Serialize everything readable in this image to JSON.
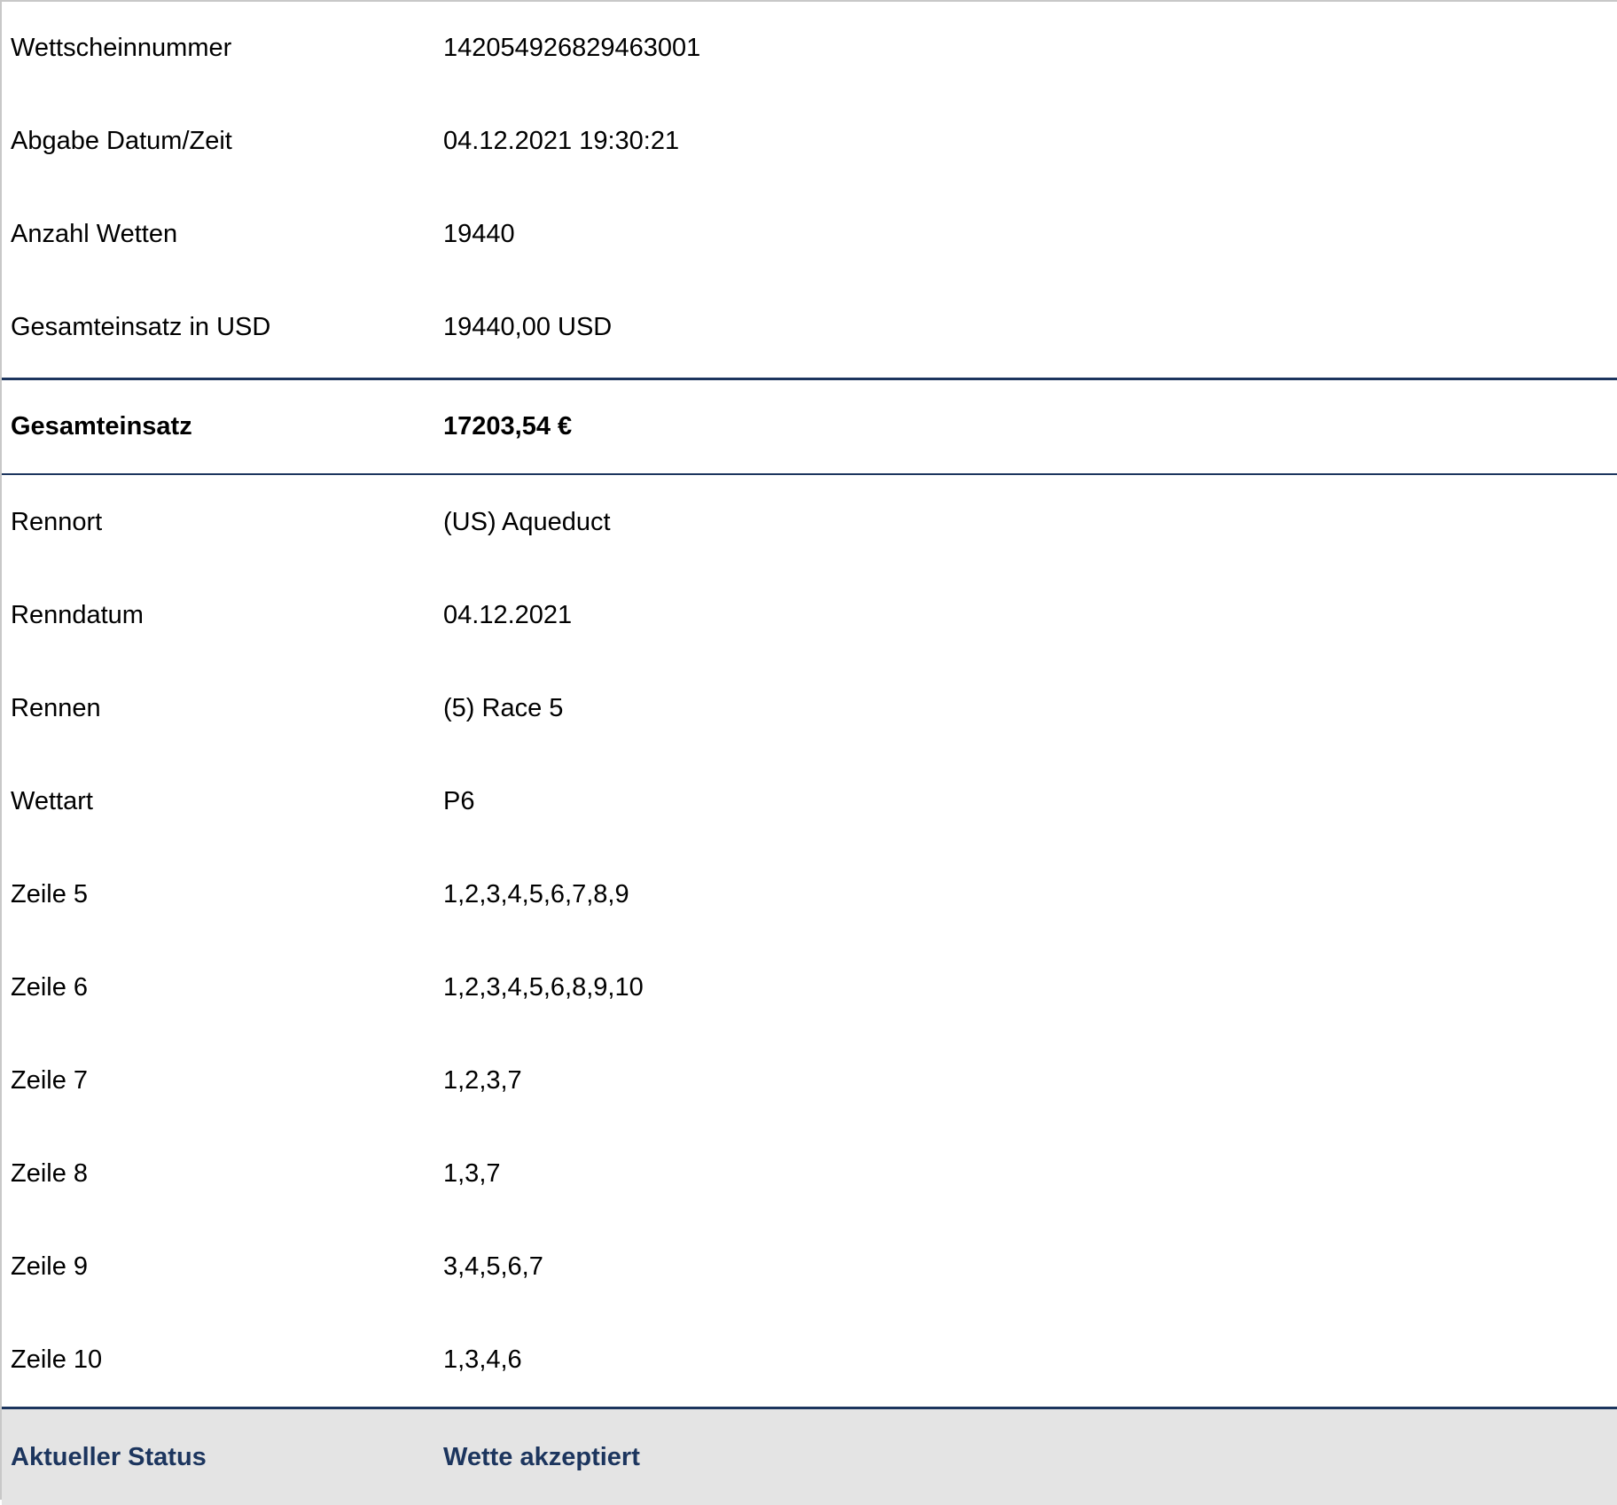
{
  "ticket": {
    "summary_rows": [
      {
        "label": "Wettscheinnummer",
        "value": "142054926829463001"
      },
      {
        "label": "Abgabe Datum/Zeit",
        "value": "04.12.2021 19:30:21"
      },
      {
        "label": "Anzahl Wetten",
        "value": "19440"
      },
      {
        "label": "Gesamteinsatz in USD",
        "value": "19440,00 USD"
      }
    ],
    "total": {
      "label": "Gesamteinsatz",
      "value": "17203,54 €"
    },
    "detail_rows": [
      {
        "label": "Rennort",
        "value": "(US) Aqueduct"
      },
      {
        "label": "Renndatum",
        "value": "04.12.2021"
      },
      {
        "label": "Rennen",
        "value": "(5) Race 5"
      },
      {
        "label": "Wettart",
        "value": "P6"
      },
      {
        "label": "Zeile 5",
        "value": "1,2,3,4,5,6,7,8,9"
      },
      {
        "label": "Zeile 6",
        "value": "1,2,3,4,5,6,8,9,10"
      },
      {
        "label": "Zeile 7",
        "value": "1,2,3,7"
      },
      {
        "label": "Zeile 8",
        "value": "1,3,7"
      },
      {
        "label": "Zeile 9",
        "value": "3,4,5,6,7"
      },
      {
        "label": "Zeile 10",
        "value": "1,3,4,6"
      }
    ],
    "status": {
      "label": "Aktueller Status",
      "value": "Wette akzeptiert"
    }
  },
  "colors": {
    "accent": "#1c355e",
    "status_background": "#e4e4e4",
    "border": "#c8c8c8"
  }
}
